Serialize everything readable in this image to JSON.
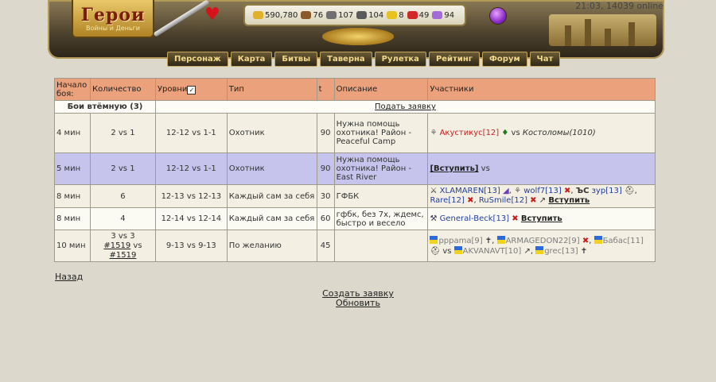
{
  "header": {
    "logo_title": "Герои",
    "logo_subtitle": "Войны и Деньги",
    "time_online": "21:03, 14039 online",
    "stats": [
      {
        "icon": "gold-icon",
        "color": "#e0b12c",
        "value": "590,780"
      },
      {
        "icon": "wood-icon",
        "color": "#8a5a2b",
        "value": "76"
      },
      {
        "icon": "ore-icon",
        "color": "#707070",
        "value": "107"
      },
      {
        "icon": "mercury-icon",
        "color": "#5a5a5a",
        "value": "104"
      },
      {
        "icon": "sulfur-icon",
        "color": "#e6c31f",
        "value": "8"
      },
      {
        "icon": "crystal-icon",
        "color": "#d22828",
        "value": "49"
      },
      {
        "icon": "gems-icon",
        "color": "#a46ad8",
        "value": "94"
      }
    ]
  },
  "nav": [
    "Персонаж",
    "Карта",
    "Битвы",
    "Таверна",
    "Рулетка",
    "Рейтинг",
    "Форум",
    "Чат"
  ],
  "table": {
    "headers": {
      "start": "Начало боя:",
      "count": "Количество",
      "levels": "Уровни",
      "type": "Тип",
      "t": "t",
      "desc": "Описание",
      "participants": "Участники"
    },
    "group_label": "Бои втёмную (3)",
    "submit_link": "Подать заявку",
    "rows": [
      {
        "start": "4 мин",
        "count": "2 vs 1",
        "levels": "12-12 vs 1-1",
        "type": "Охотник",
        "t": "90",
        "desc": "Нужна помощь охотника! Район - Peaceful Camp",
        "p1": "Акустикус[12]",
        "vs": "vs",
        "p2": "Костоломы(1010)"
      },
      {
        "start": "5 мин",
        "count": "2 vs 1",
        "levels": "12-12 vs 1-1",
        "type": "Охотник",
        "t": "90",
        "desc": "Нужна помощь охотника! Район - East River",
        "join": "[Вступить]",
        "vs": "vs"
      },
      {
        "start": "8 мин",
        "count": "6",
        "levels": "12-13 vs 12-13",
        "type": "Каждый сам за себя",
        "t": "30",
        "desc": "ГФБК",
        "players": [
          "XLAMAREN[13]",
          "wolf7[13]",
          "зур[13]",
          "Rare[12]",
          "RuSmile[12]"
        ],
        "join": "Вступить"
      },
      {
        "start": "8 мин",
        "count": "4",
        "levels": "12-14 vs 12-14",
        "type": "Каждый сам за себя",
        "t": "60",
        "desc": "гфбк, без 7х, ждемс, быстро и весело",
        "players": [
          "General-Beck[13]"
        ],
        "join": "Вступить"
      },
      {
        "start": "10 мин",
        "count_a": "3 vs 3",
        "count_b": "#1519",
        "count_vs": "vs",
        "count_c": "#1519",
        "levels": "9-13 vs 9-13",
        "type": "По желанию",
        "t": "45",
        "desc": "",
        "team1": [
          "pppama[9]",
          "ARMAGEDON22[9]",
          "Бабас[11]"
        ],
        "vs": "vs",
        "team2": [
          "AKVANAVT[10]",
          "grec[13]"
        ]
      }
    ]
  },
  "links": {
    "back": "Назад",
    "create": "Создать заявку",
    "refresh": "Обновить"
  }
}
